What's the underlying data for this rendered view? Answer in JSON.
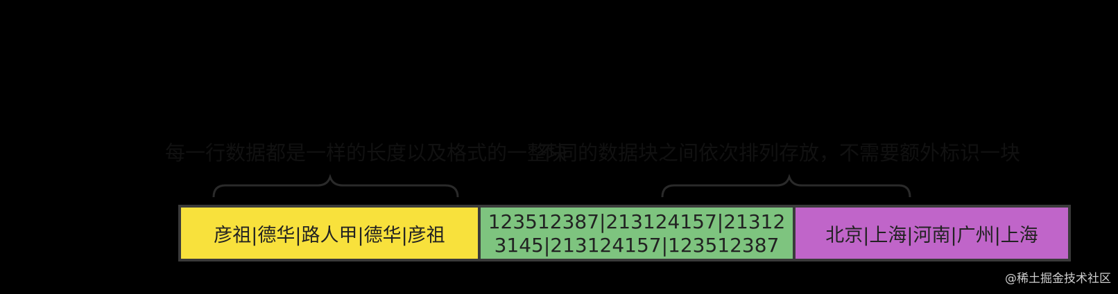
{
  "annotations": {
    "left": "每一行数据都是一样的长度以及格式的一整块",
    "right": "不同的数据块之间依次排列存放，不需要额外标识一块"
  },
  "segments": [
    {
      "text": "彦祖|德华|路人甲|德华|彦祖",
      "color": "#f8e13c"
    },
    {
      "lines": [
        "123512387|213124157|21312",
        "3145|213124157|123512387"
      ],
      "color": "#7ec47f"
    },
    {
      "text": "北京|上海|河南|广州|上海",
      "color": "#c065c9"
    }
  ],
  "watermark": "@稀土掘金技术社区"
}
